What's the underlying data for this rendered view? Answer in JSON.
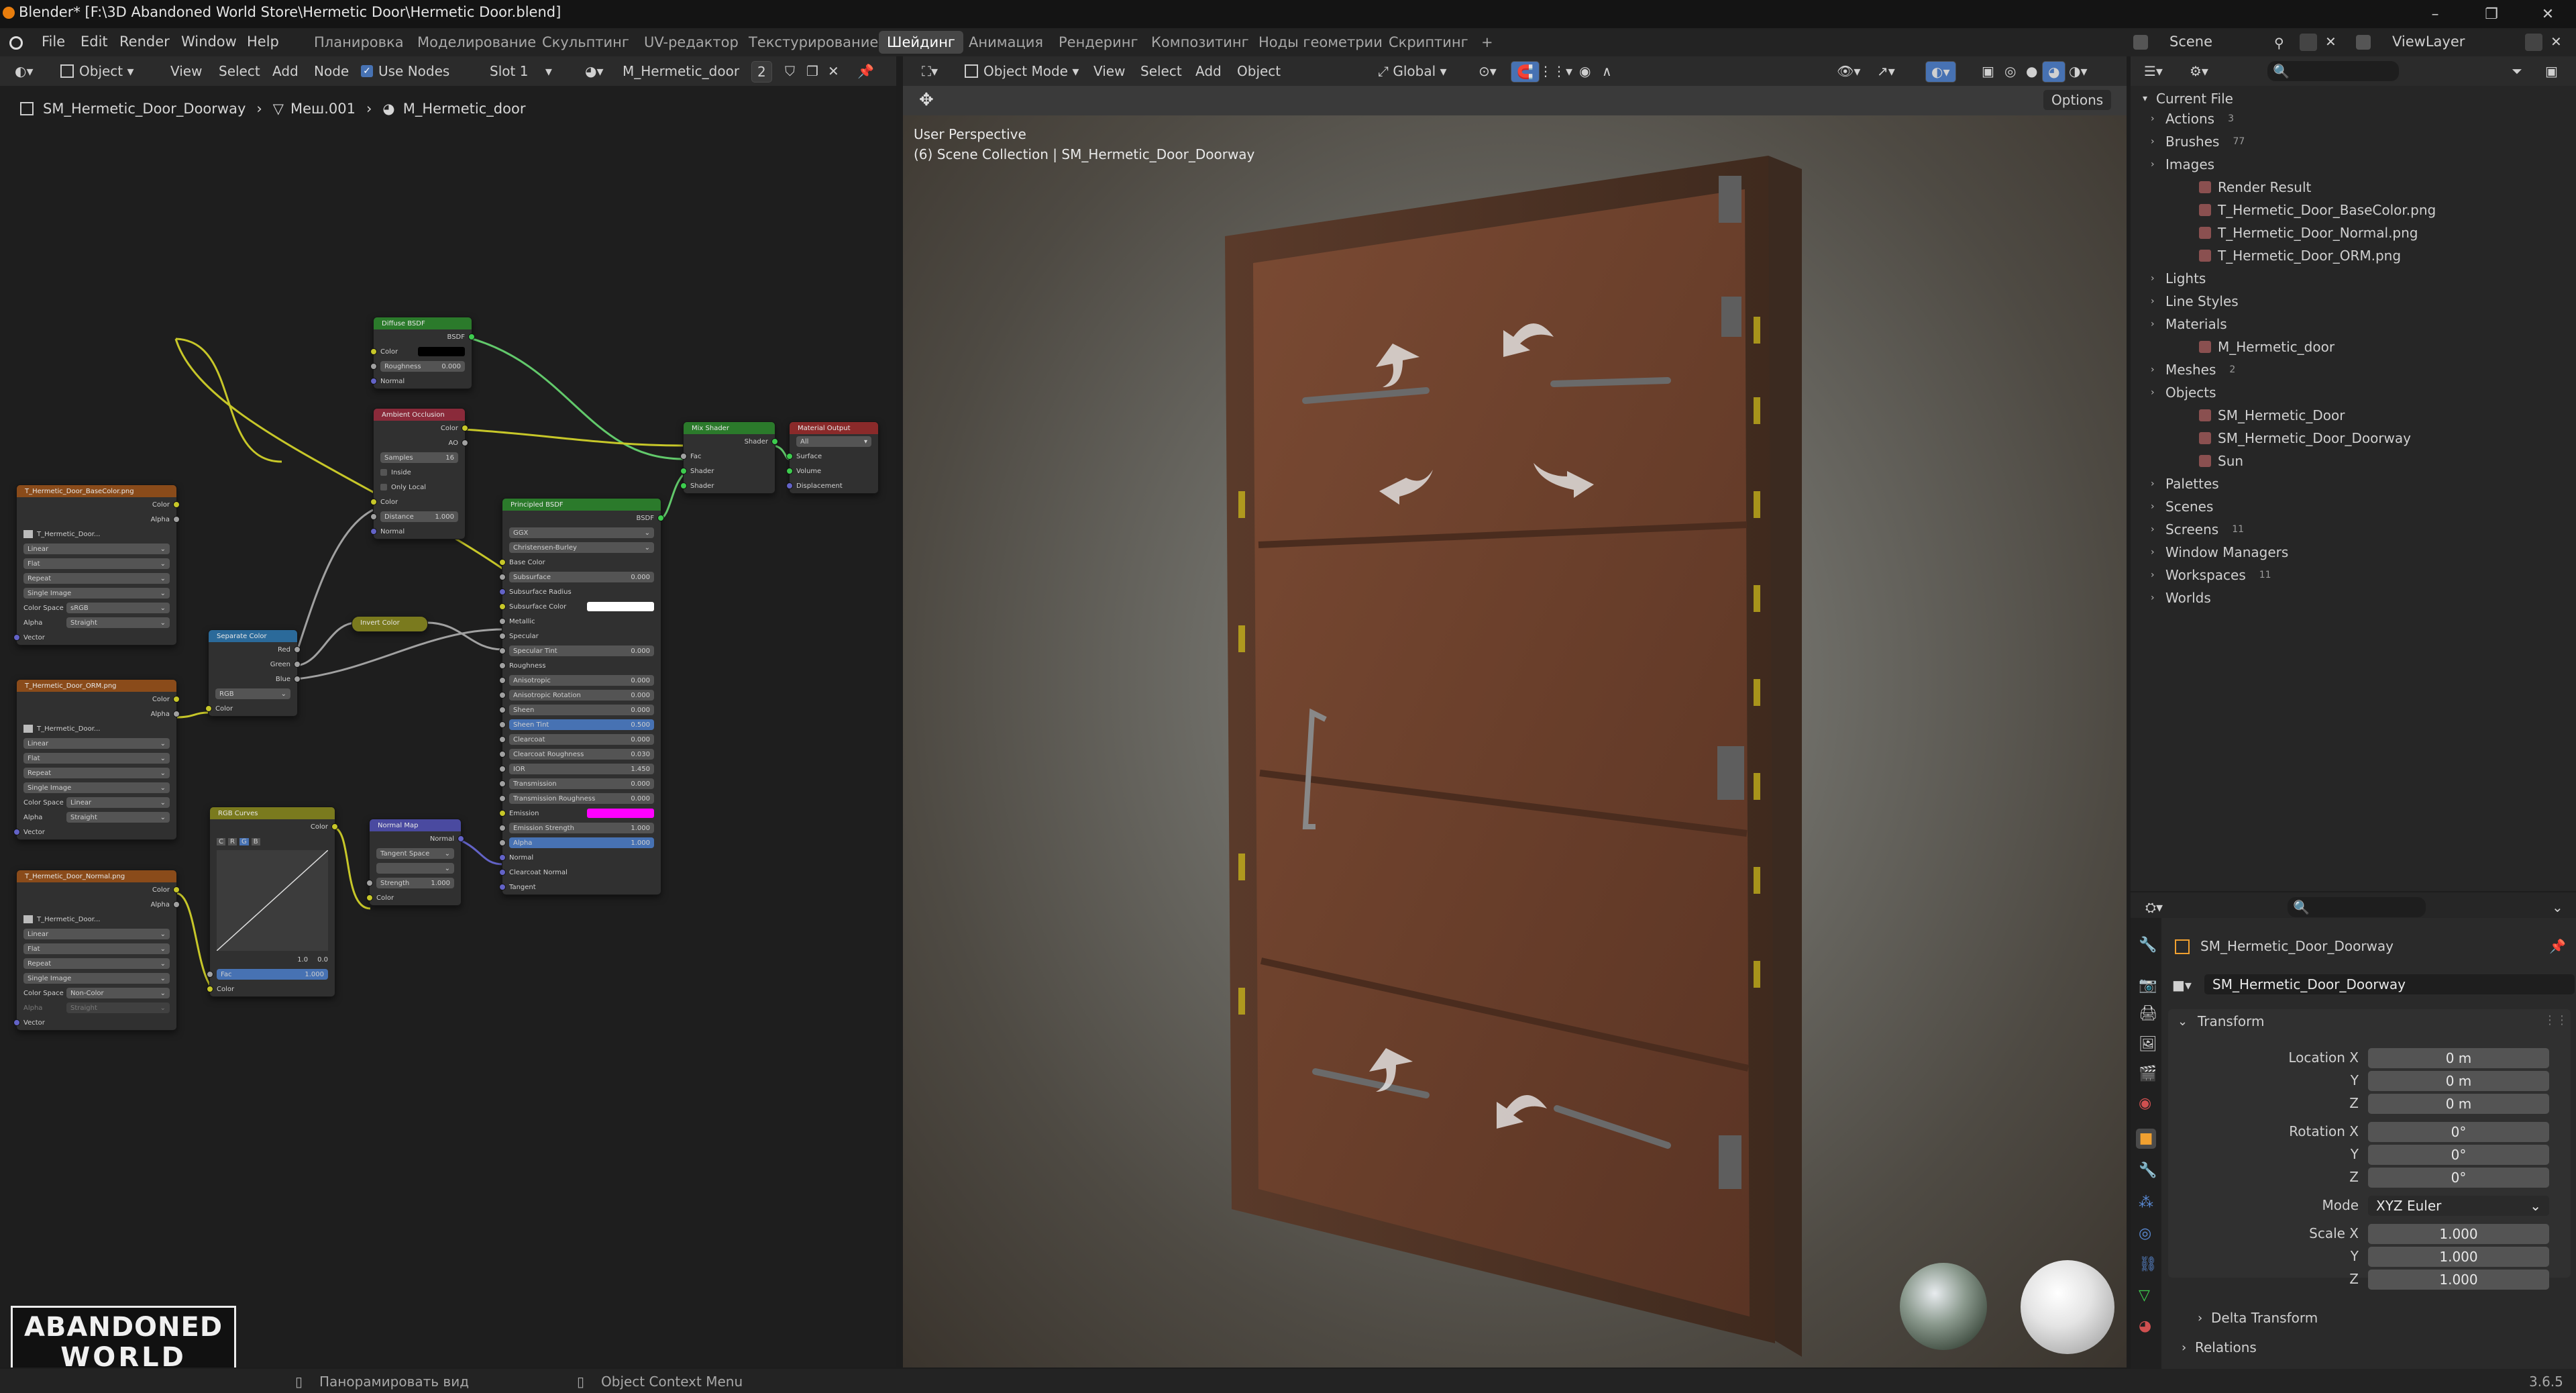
{
  "window": {
    "title": "Blender* [F:\\3D Abandoned World Store\\Hermetic Door\\Hermetic Door.blend]"
  },
  "menus": [
    "File",
    "Edit",
    "Render",
    "Window",
    "Help"
  ],
  "workspaces": [
    "Планировка",
    "Моделирование",
    "Скульптинг",
    "UV-редактор",
    "Текстурирование",
    "Шейдинг",
    "Анимация",
    "Рендеринг",
    "Композитинг",
    "Ноды геометрии",
    "Скриптинг"
  ],
  "active_workspace": "Шейдинг",
  "scene_name": "Scene",
  "view_layer": "ViewLayer",
  "node_header": {
    "object_label": "Object",
    "menus": [
      "View",
      "Select",
      "Add",
      "Node"
    ],
    "use_nodes": "Use Nodes",
    "slot": "Slot 1",
    "material": "M_Hermetic_door",
    "users": "2"
  },
  "breadcrumb": [
    "SM_Hermetic_Door_Doorway",
    "Меш.001",
    "M_Hermetic_door"
  ],
  "nodes": {
    "diffuse": {
      "title": "Diffuse BSDF",
      "out": "BSDF",
      "rows": [
        "Color",
        "Roughness",
        "Normal"
      ],
      "roughness": "0.000"
    },
    "ao": {
      "title": "Ambient Occlusion",
      "outs": [
        "Color",
        "AO"
      ],
      "samples": "16",
      "inside": "Inside",
      "only_local": "Only Local",
      "color": "Color",
      "distance_label": "Distance",
      "distance": "1.000",
      "normal": "Normal"
    },
    "mix": {
      "title": "Mix Shader",
      "out": "Shader",
      "ins": [
        "Fac",
        "Shader",
        "Shader"
      ]
    },
    "output": {
      "title": "Material Output",
      "target": "All",
      "ins": [
        "Surface",
        "Volume",
        "Displacement"
      ]
    },
    "basecolor": {
      "title": "T_Hermetic_Door_BaseColor.png",
      "outs": [
        "Color",
        "Alpha"
      ],
      "img": "T_Hermetic_Door...",
      "interp": "Linear",
      "proj": "Flat",
      "ext": "Repeat",
      "src": "Single Image",
      "cs_label": "Color Space",
      "cs": "sRGB",
      "alpha_label": "Alpha",
      "alpha": "Straight",
      "vector": "Vector"
    },
    "orm": {
      "title": "T_Hermetic_Door_ORM.png",
      "outs": [
        "Color",
        "Alpha"
      ],
      "img": "T_Hermetic_Door...",
      "interp": "Linear",
      "proj": "Flat",
      "ext": "Repeat",
      "src": "Single Image",
      "cs_label": "Color Space",
      "cs": "Linear",
      "alpha_label": "Alpha",
      "alpha": "Straight",
      "vector": "Vector"
    },
    "normaltex": {
      "title": "T_Hermetic_Door_Normal.png",
      "outs": [
        "Color",
        "Alpha"
      ],
      "img": "T_Hermetic_Door...",
      "interp": "Linear",
      "proj": "Flat",
      "ext": "Repeat",
      "src": "Single Image",
      "cs_label": "Color Space",
      "cs": "Non-Color",
      "alpha_label": "Alpha",
      "alpha": "Straight",
      "vector": "Vector"
    },
    "separate": {
      "title": "Separate Color",
      "outs": [
        "Red",
        "Green",
        "Blue"
      ],
      "mode": "RGB",
      "in": "Color"
    },
    "invert": {
      "title": "Invert Color"
    },
    "curves": {
      "title": "RGB Curves",
      "out": "Color",
      "channels": [
        "C",
        "R",
        "G",
        "B"
      ],
      "v1": "1.0",
      "v2": "0.0",
      "fac_label": "Fac",
      "fac": "1.000",
      "in": "Color"
    },
    "normalmap": {
      "title": "Normal Map",
      "out": "Normal",
      "space": "Tangent Space",
      "strength_label": "Strength",
      "strength": "1.000",
      "in": "Color"
    },
    "principled": {
      "title": "Principled BSDF",
      "out": "BSDF",
      "dist": "GGX",
      "sss": "Christensen-Burley",
      "rows": [
        {
          "label": "Base Color",
          "value": ""
        },
        {
          "label": "Subsurface",
          "value": "0.000"
        },
        {
          "label": "Subsurface Radius",
          "value": ""
        },
        {
          "label": "Subsurface Color",
          "value": ""
        },
        {
          "label": "Metallic",
          "value": ""
        },
        {
          "label": "Specular",
          "value": ""
        },
        {
          "label": "Specular Tint",
          "value": "0.000"
        },
        {
          "label": "Roughness",
          "value": ""
        },
        {
          "label": "Anisotropic",
          "value": "0.000"
        },
        {
          "label": "Anisotropic Rotation",
          "value": "0.000"
        },
        {
          "label": "Sheen",
          "value": "0.000"
        },
        {
          "label": "Sheen Tint",
          "value": "0.500"
        },
        {
          "label": "Clearcoat",
          "value": "0.000"
        },
        {
          "label": "Clearcoat Roughness",
          "value": "0.030"
        },
        {
          "label": "IOR",
          "value": "1.450"
        },
        {
          "label": "Transmission",
          "value": "0.000"
        },
        {
          "label": "Transmission Roughness",
          "value": "0.000"
        },
        {
          "label": "Emission",
          "value": ""
        },
        {
          "label": "Emission Strength",
          "value": "1.000"
        },
        {
          "label": "Alpha",
          "value": "1.000"
        },
        {
          "label": "Normal",
          "value": ""
        },
        {
          "label": "Clearcoat Normal",
          "value": ""
        },
        {
          "label": "Tangent",
          "value": ""
        }
      ]
    }
  },
  "viewport_header": {
    "mode": "Object Mode",
    "menus": [
      "View",
      "Select",
      "Add",
      "Object"
    ],
    "orientation": "Global",
    "options": "Options"
  },
  "viewport_overlay": {
    "line1": "User Perspective",
    "line2": "(6) Scene Collection | SM_Hermetic_Door_Doorway"
  },
  "outliner": {
    "root": "Current File",
    "items": [
      {
        "label": "Actions",
        "count": "3"
      },
      {
        "label": "Brushes",
        "count": "77"
      },
      {
        "label": "Images"
      },
      {
        "label": "Render Result",
        "child": true
      },
      {
        "label": "T_Hermetic_Door_BaseColor.png",
        "child": true
      },
      {
        "label": "T_Hermetic_Door_Normal.png",
        "child": true
      },
      {
        "label": "T_Hermetic_Door_ORM.png",
        "child": true
      },
      {
        "label": "Lights"
      },
      {
        "label": "Line Styles"
      },
      {
        "label": "Materials"
      },
      {
        "label": "M_Hermetic_door",
        "child": true
      },
      {
        "label": "Meshes",
        "count": "2"
      },
      {
        "label": "Objects"
      },
      {
        "label": "SM_Hermetic_Door",
        "child": true
      },
      {
        "label": "SM_Hermetic_Door_Doorway",
        "child": true
      },
      {
        "label": "Sun",
        "child": true
      },
      {
        "label": "Palettes"
      },
      {
        "label": "Scenes"
      },
      {
        "label": "Screens",
        "count": "11"
      },
      {
        "label": "Window Managers"
      },
      {
        "label": "Workspaces",
        "count": "11"
      },
      {
        "label": "Worlds"
      }
    ]
  },
  "properties": {
    "object_name": "SM_Hermetic_Door_Doorway",
    "data_name": "SM_Hermetic_Door_Doorway",
    "transform": "Transform",
    "location_label": "Location X",
    "loc": [
      "0 m",
      "0 m",
      "0 m"
    ],
    "rotation_label": "Rotation X",
    "rot": [
      "0°",
      "0°",
      "0°"
    ],
    "mode_label": "Mode",
    "mode": "XYZ Euler",
    "scale_label": "Scale X",
    "scale": [
      "1.000",
      "1.000",
      "1.000"
    ],
    "y": "Y",
    "z": "Z",
    "delta": "Delta Transform",
    "relations": "Relations"
  },
  "logo": {
    "line1": "ABANDONED",
    "line2": "WORLD"
  },
  "statusbar": {
    "hint1": "Панорамировать вид",
    "hint2": "Object Context Menu",
    "version": "3.6.5"
  },
  "colors": {
    "accent": "#4772b3",
    "node_shader": "#2b7a2b",
    "node_texture": "#8a4b1a",
    "node_converter": "#2b6a9a",
    "node_color": "#7a7a1e",
    "node_vector": "#4a4aa0",
    "node_output": "#8a2a2a"
  }
}
